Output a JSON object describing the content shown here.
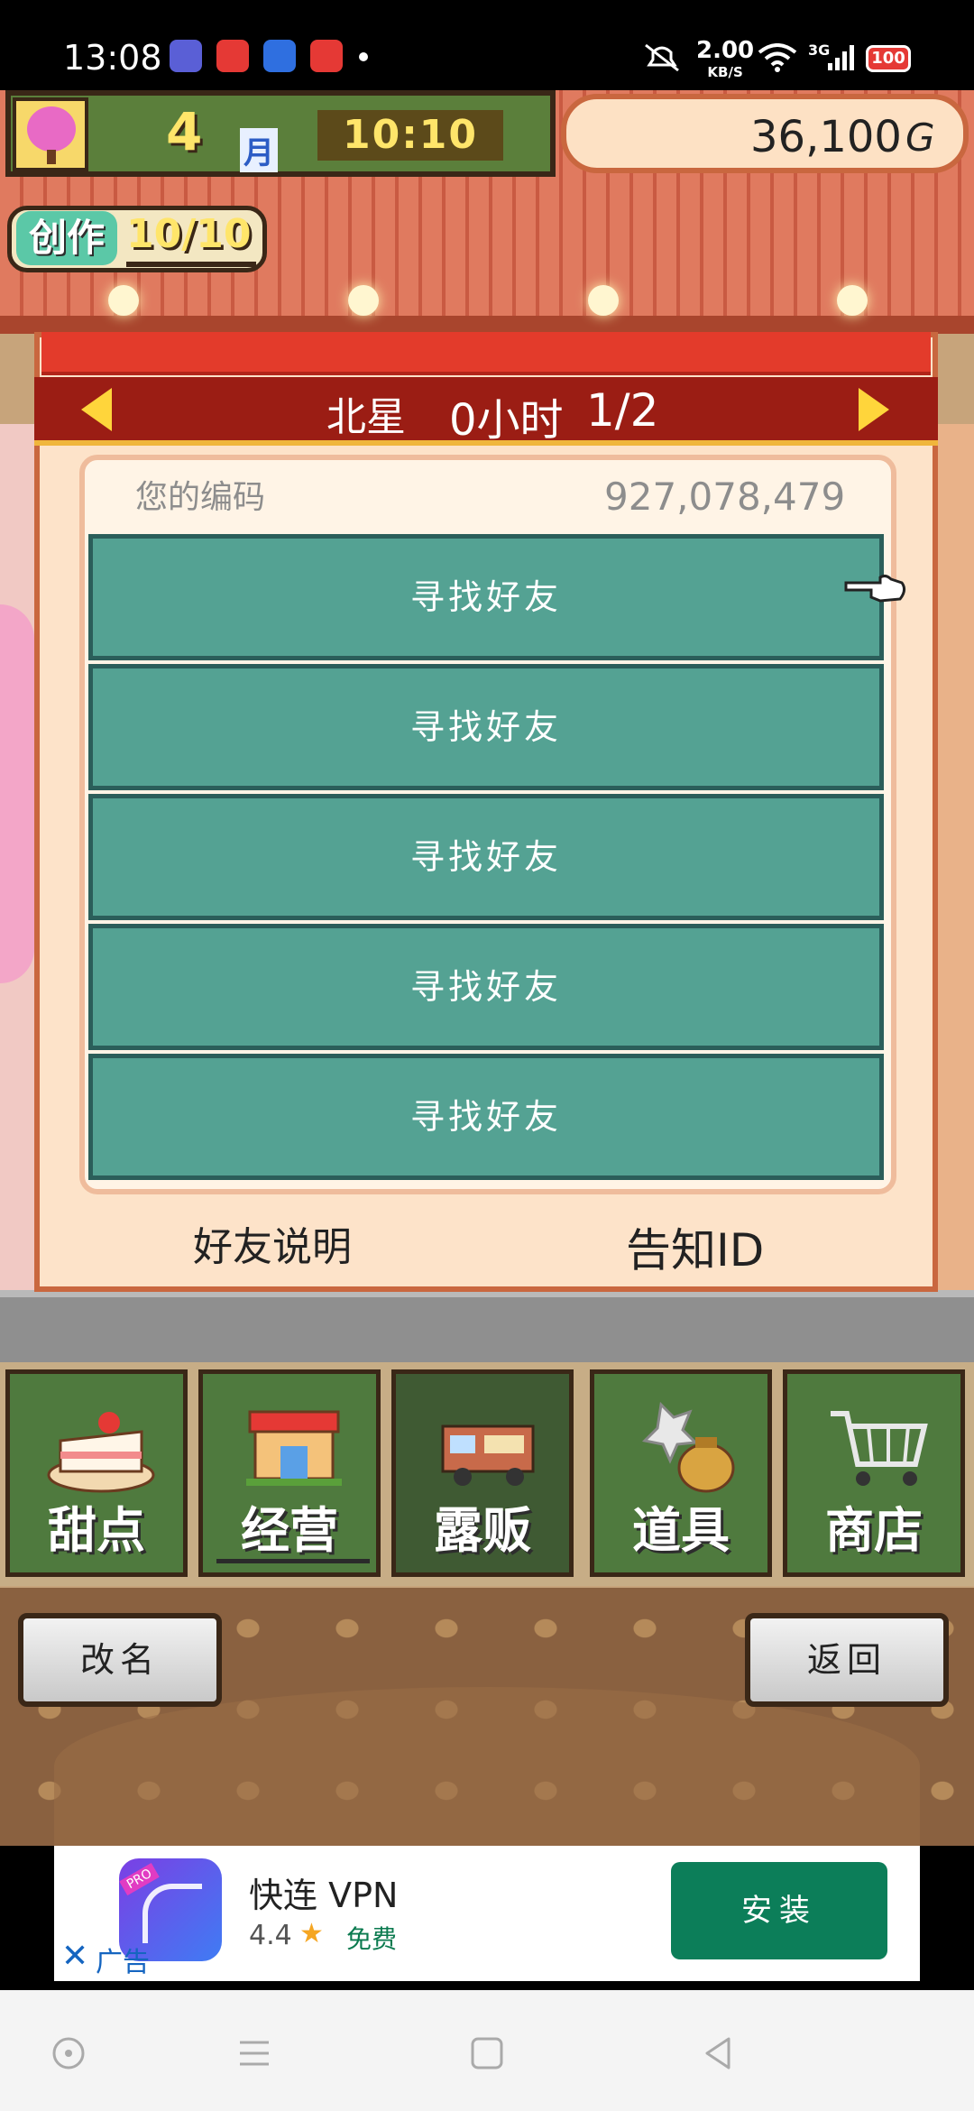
{
  "status_bar": {
    "time": "13:08",
    "network_speed": "2.00",
    "network_unit": "KB/S",
    "network_type": "3G",
    "battery": "100",
    "app_icons": [
      "app-icon-1",
      "app-icon-2",
      "app-icon-3",
      "app-icon-4"
    ]
  },
  "hud": {
    "month_number": "4",
    "month_label": "月",
    "clock": "10:10",
    "money": "36,100",
    "currency": "G",
    "create_label": "创作",
    "create_count": "10/10"
  },
  "dialog": {
    "title": "北星",
    "hours": "0小时",
    "page": "1/2",
    "code_label": "您的编码",
    "code_value": "927,078,479",
    "friend_slots": [
      {
        "label": "寻找好友"
      },
      {
        "label": "寻找好友"
      },
      {
        "label": "寻找好友"
      },
      {
        "label": "寻找好友"
      },
      {
        "label": "寻找好友"
      }
    ],
    "explain_link": "好友说明",
    "notify_link": "告知ID"
  },
  "bottom_nav": {
    "tabs": [
      {
        "label": "甜点",
        "icon": "cake-icon",
        "active": false
      },
      {
        "label": "经营",
        "icon": "shop-icon",
        "active": false
      },
      {
        "label": "露贩",
        "icon": "truck-icon",
        "active": true
      },
      {
        "label": "道具",
        "icon": "item-bag-icon",
        "active": false
      },
      {
        "label": "商店",
        "icon": "cart-icon",
        "active": false
      }
    ]
  },
  "actions": {
    "rename": "改名",
    "back": "返回"
  },
  "ad": {
    "app_name": "快连 VPN",
    "rating": "4.4",
    "price": "免费",
    "tag": "广告",
    "install": "安装",
    "close": "✕",
    "badge": "PRO"
  },
  "colors": {
    "friend_slot": "#54a293",
    "dialog_header": "#9b1d14",
    "install_button": "#0c7e59"
  }
}
